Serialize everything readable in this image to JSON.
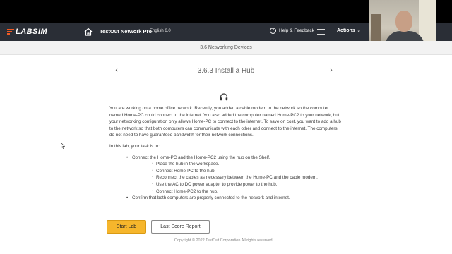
{
  "header": {
    "logo_text": "LABSIM",
    "product": "TestOut Network Pro",
    "language": "English 6.0",
    "help_label": "Help & Feedback",
    "actions_label": "Actions"
  },
  "subheader": {
    "section": "3.6 Networking Devices"
  },
  "lesson": {
    "title": "3.6.3 Install a Hub",
    "intro": "You are working on a home office network. Recently, you added a cable modem to the network so the computer named Home-PC could connect to the internet. You also added the computer named Home-PC2 to your network, but your networking configuration only allows Home-PC to connect to the internet. To save on cost, you want to add a hub to the network so that both computers can communicate with each other and connect to the internet. The computers do not need to have guaranteed bandwidth for their network connections.",
    "task_lead": "In this lab, your task is to:",
    "tasks": [
      {
        "text": "Connect the Home-PC and the Home-PC2 using the hub on the Shelf.",
        "subtasks": [
          "Place the hub in the workspace.",
          "Connect Home-PC to the hub.",
          "Reconnect the cables as necessary between the Home-PC and the cable modem.",
          "Use the AC to DC power adapter to provide power to the hub.",
          "Connect Home-PC2 to the hub."
        ]
      },
      {
        "text": "Confirm that both computers are properly connected to the network and internet."
      }
    ]
  },
  "buttons": {
    "start": "Start Lab",
    "report": "Last Score Report"
  },
  "footer": {
    "copyright": "Copyright © 2022 TestOut Corporation  All rights reserved."
  },
  "colors": {
    "appbar": "#2a2e36",
    "accent": "#f15a24",
    "start_button": "#f6b62c"
  },
  "icons": [
    "home-icon",
    "help-icon",
    "menu-icon",
    "chevron-left-icon",
    "chevron-right-icon",
    "headphones-icon"
  ]
}
